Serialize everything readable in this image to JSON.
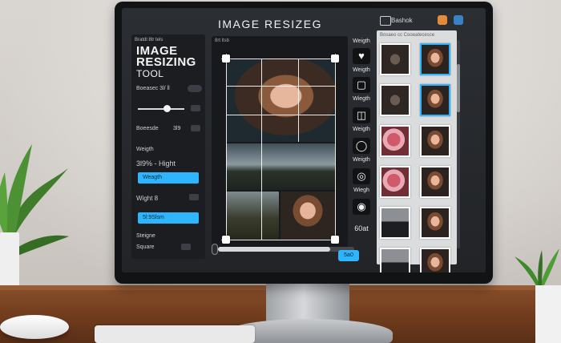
{
  "app": {
    "title": "IMAGE RESIZEG",
    "account_label": "Bashok"
  },
  "left_panel": {
    "crumb": "Bratdl 8tr tels",
    "title_line1": "IMAGE",
    "title_line2": "RESIZING",
    "title_line3": "TOOL",
    "row_top": "Boeasec  3l/  ll",
    "field_dim_label": "Boeesde",
    "field_dim_value": "3l9",
    "weight_label": "Weigth",
    "size_value": "3l9% - Hight",
    "width_button": "Weagth",
    "weight_row": "Wight 8",
    "preset_button": "5l:9Slsm",
    "option_1": "Steigne",
    "option_2": "Square"
  },
  "canvas": {
    "label": "8rt   ltsb"
  },
  "toolbar": {
    "labels": [
      "Weigth",
      "Weigth",
      "Wiegth",
      "Weigth",
      "Weigth",
      "Wiegh",
      "60at"
    ],
    "icons": [
      "heart-icon",
      "crop-icon",
      "frame-icon",
      "circle-icon",
      "lock-icon",
      "shape-icon"
    ]
  },
  "right_panel": {
    "header": "Bosaeo cc  Cooeatecesce",
    "thumbnails": [
      {
        "kind": "dark",
        "selected": false
      },
      {
        "kind": "portrait",
        "selected": true
      },
      {
        "kind": "dark",
        "selected": false
      },
      {
        "kind": "portrait",
        "selected": true
      },
      {
        "kind": "flower",
        "selected": false
      },
      {
        "kind": "portrait",
        "selected": false
      },
      {
        "kind": "flower",
        "selected": false
      },
      {
        "kind": "portrait",
        "selected": false
      },
      {
        "kind": "suit",
        "selected": false
      },
      {
        "kind": "portrait",
        "selected": false
      },
      {
        "kind": "suit",
        "selected": false
      },
      {
        "kind": "portrait",
        "selected": false
      },
      {
        "kind": "kid",
        "selected": false
      },
      {
        "kind": "portrait",
        "selected": false
      }
    ]
  },
  "bottom_bar": {
    "go_button": "5a0"
  },
  "colors": {
    "accent": "#2fb5ff",
    "panel_dark": "#1b1d20",
    "right_panel": "#dadcde"
  }
}
